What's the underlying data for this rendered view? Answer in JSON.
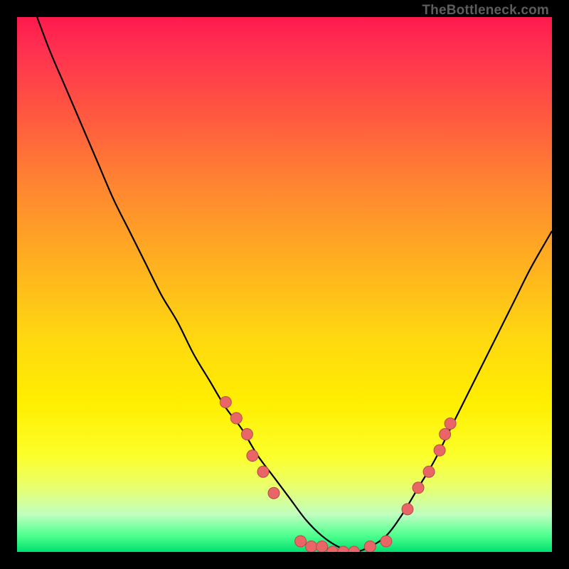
{
  "watermark": "TheBottleneck.com",
  "colors": {
    "frame": "#000000",
    "curve": "#000000",
    "point_fill": "#ea6666",
    "point_stroke": "#b44b4b",
    "grad_top": "#ff1a4d",
    "grad_bottom": "#00e070"
  },
  "chart_data": {
    "type": "line",
    "title": "",
    "xlabel": "",
    "ylabel": "",
    "x_range": [
      0,
      100
    ],
    "y_range": [
      0,
      100
    ],
    "series": [
      {
        "name": "curve",
        "x": [
          0,
          3,
          6,
          9,
          12,
          15,
          18,
          21,
          24,
          27,
          30,
          33,
          36,
          39,
          42,
          45,
          48,
          51,
          54,
          57,
          60,
          63,
          66,
          69,
          72,
          75,
          78,
          81,
          84,
          87,
          90,
          93,
          96,
          100
        ],
        "y": [
          110,
          102,
          94,
          87,
          80,
          73,
          66,
          60,
          54,
          48,
          43,
          37,
          32,
          27,
          23,
          18,
          14,
          10,
          6,
          3,
          1,
          0,
          1,
          3,
          7,
          12,
          17,
          23,
          29,
          35,
          41,
          47,
          53,
          60
        ]
      }
    ],
    "points": [
      {
        "x": 39,
        "y": 28
      },
      {
        "x": 41,
        "y": 25
      },
      {
        "x": 43,
        "y": 22
      },
      {
        "x": 44,
        "y": 18
      },
      {
        "x": 46,
        "y": 15
      },
      {
        "x": 48,
        "y": 11
      },
      {
        "x": 53,
        "y": 2
      },
      {
        "x": 55,
        "y": 1
      },
      {
        "x": 57,
        "y": 1
      },
      {
        "x": 59,
        "y": 0
      },
      {
        "x": 61,
        "y": 0
      },
      {
        "x": 63,
        "y": 0
      },
      {
        "x": 66,
        "y": 1
      },
      {
        "x": 69,
        "y": 2
      },
      {
        "x": 73,
        "y": 8
      },
      {
        "x": 75,
        "y": 12
      },
      {
        "x": 77,
        "y": 15
      },
      {
        "x": 79,
        "y": 19
      },
      {
        "x": 80,
        "y": 22
      },
      {
        "x": 81,
        "y": 24
      }
    ],
    "point_radius": 8
  }
}
